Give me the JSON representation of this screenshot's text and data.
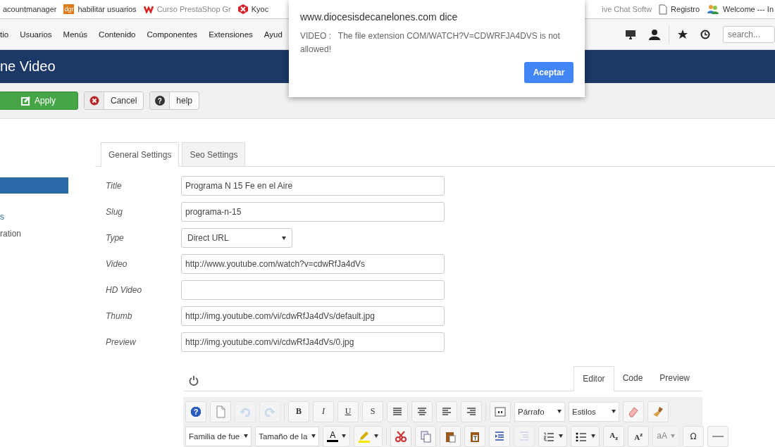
{
  "bookmarks": [
    {
      "label": "acountmanager",
      "kind": "plain",
      "faded": false
    },
    {
      "label": "habilitar usuarios",
      "kind": "dgr",
      "icon_text": "dgr",
      "faded": false
    },
    {
      "label": "Curso PrestaShop Gr",
      "kind": "w",
      "faded": true
    },
    {
      "label": "Kyoc",
      "kind": "kyo",
      "faded": false
    },
    {
      "label": "ive Chat Softw",
      "kind": "plain",
      "faded": true
    },
    {
      "label": "Registro",
      "kind": "page",
      "faded": false
    },
    {
      "label": "Welcome --- In",
      "kind": "people",
      "faded": false
    }
  ],
  "menu": [
    "tio",
    "Usuarios",
    "Menús",
    "Contenido",
    "Componentes",
    "Extensiones",
    "Ayud"
  ],
  "search": {
    "placeholder": "search..."
  },
  "header": {
    "title": "ne Video"
  },
  "actions": [
    {
      "label": "Apply",
      "kind": "primary"
    },
    {
      "label": "Cancel",
      "kind": "cancel"
    },
    {
      "label": "help",
      "kind": "help",
      "glyph": "?"
    }
  ],
  "sidebar": [
    {
      "selected": true
    },
    {
      "label": "s",
      "selected": false,
      "link": true
    },
    {
      "label": "ration",
      "selected": false,
      "link": false
    }
  ],
  "tabs": [
    {
      "label": "General Settings",
      "selected": true
    },
    {
      "label": "Seo Settings",
      "selected": false
    }
  ],
  "fields": [
    {
      "label": "Title",
      "kind": "text",
      "value": "Programa N 15 Fe en el Aire"
    },
    {
      "label": "Slug",
      "kind": "text",
      "value": "programa-n-15"
    },
    {
      "label": "Type",
      "kind": "select",
      "value": "Direct URL"
    },
    {
      "label": "Video",
      "kind": "text",
      "value": "http://www.youtube.com/watch?v=cdwRfJa4dVs"
    },
    {
      "label": "HD Video",
      "kind": "text"
    },
    {
      "label": "Thumb",
      "kind": "text",
      "value": "http://img.youtube.com/vi/cdwRfJa4dVs/default.jpg"
    },
    {
      "label": "Preview",
      "kind": "text",
      "value": "http://img.youtube.com/vi/cdwRfJa4dVs/0.jpg"
    }
  ],
  "editor_tabs": [
    {
      "label": "Editor",
      "selected": true
    },
    {
      "label": "Code",
      "selected": false
    },
    {
      "label": "Preview",
      "selected": false
    }
  ],
  "editor_toolbar": [
    [
      {
        "kind": "glyph",
        "glyph": "?",
        "disabled": false
      },
      {
        "kind": "icon",
        "disabled": false
      },
      {
        "kind": "icon",
        "disabled": true
      },
      {
        "kind": "icon",
        "disabled": true
      },
      {
        "kind": "sep"
      },
      {
        "kind": "bold",
        "label": "B"
      },
      {
        "kind": "italic",
        "label": "I"
      },
      {
        "kind": "underline",
        "label": "U"
      },
      {
        "kind": "strike",
        "label": "S"
      },
      {
        "kind": "icon",
        "disabled": false
      },
      {
        "kind": "icon",
        "disabled": false
      },
      {
        "kind": "icon",
        "disabled": false
      },
      {
        "kind": "icon",
        "disabled": false
      },
      {
        "kind": "sep"
      },
      {
        "kind": "icon",
        "disabled": false
      },
      {
        "kind": "select",
        "value": "Párrafo"
      },
      {
        "kind": "select",
        "value": "Estilos"
      },
      {
        "kind": "icon",
        "disabled": false
      },
      {
        "kind": "icon",
        "disabled": false
      }
    ],
    [
      {
        "kind": "select",
        "value": "Familia de fue"
      },
      {
        "kind": "select",
        "value": "Tamaño de la"
      },
      {
        "kind": "split",
        "glyph": "A",
        "color": "#000000",
        "disabled": false
      },
      {
        "kind": "split",
        "color": "#f5e900",
        "disabled": false
      },
      {
        "kind": "sep"
      },
      {
        "kind": "icon",
        "disabled": false
      },
      {
        "kind": "icon",
        "disabled": false
      },
      {
        "kind": "icon",
        "disabled": false
      },
      {
        "kind": "icon",
        "disabled": false
      },
      {
        "kind": "icon",
        "disabled": false
      },
      {
        "kind": "icon",
        "disabled": true
      },
      {
        "kind": "split",
        "disabled": false
      },
      {
        "kind": "split",
        "disabled": false
      },
      {
        "kind": "script",
        "label": "A$_{z}$"
      },
      {
        "kind": "script",
        "label": "A$^{z}$"
      },
      {
        "kind": "split",
        "glyph": "aA",
        "disabled": true
      },
      {
        "kind": "glyph",
        "glyph": "Ω",
        "disabled": false
      },
      {
        "kind": "icon",
        "disabled": false
      }
    ]
  ],
  "dialog": {
    "title": "www.diocesisdecanelones.com dice",
    "message": "VIDEO :   The file extension COM/WATCH?V=CDWRFJA4DVS is not allowed!",
    "button": "Aceptar"
  }
}
